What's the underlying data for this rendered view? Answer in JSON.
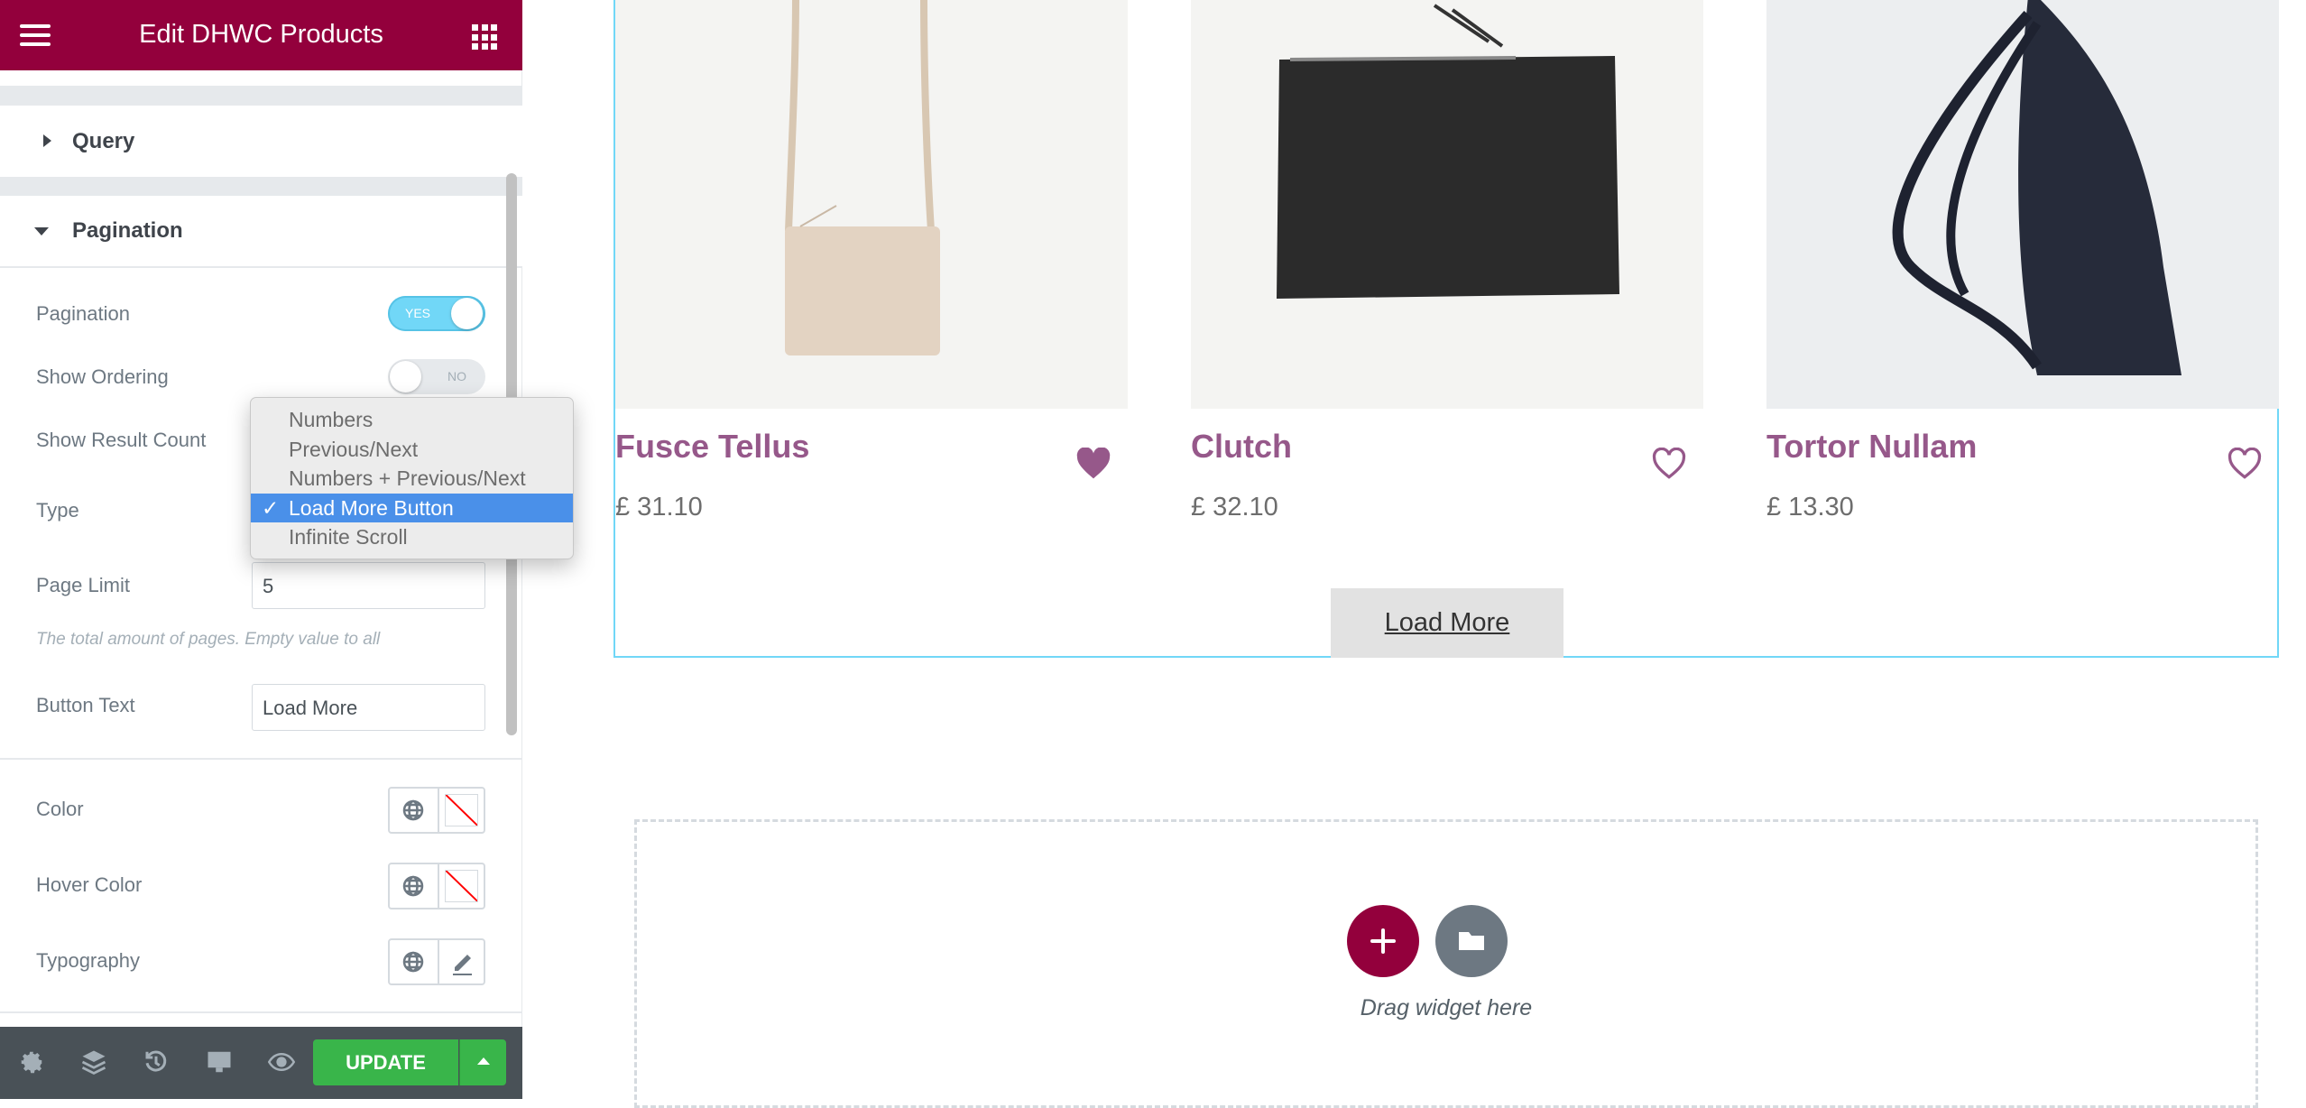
{
  "header": {
    "title": "Edit DHWC Products",
    "menu_icon": "hamburger-icon",
    "apps_icon": "grid-icon",
    "color": "#93003c"
  },
  "sections": {
    "query": "Query",
    "pagination": "Pagination"
  },
  "controls": {
    "pagination": {
      "label": "Pagination",
      "state": "YES"
    },
    "show_ordering": {
      "label": "Show Ordering",
      "state": "NO"
    },
    "show_result_count": {
      "label": "Show Result Count"
    },
    "type": {
      "label": "Type",
      "options": [
        "Numbers",
        "Previous/Next",
        "Numbers + Previous/Next",
        "Load More Button",
        "Infinite Scroll"
      ],
      "selected": "Load More Button",
      "check": "✓"
    },
    "page_limit": {
      "label": "Page Limit",
      "value": "5",
      "help": "The total amount of pages. Empty value to all"
    },
    "button_text": {
      "label": "Button Text",
      "value": "Load More"
    },
    "color": {
      "label": "Color"
    },
    "hover_color": {
      "label": "Hover Color"
    },
    "typography": {
      "label": "Typography"
    }
  },
  "footer": {
    "update": "UPDATE",
    "icons": [
      "gear-icon",
      "layers-icon",
      "history-icon",
      "desktop-icon",
      "eye-icon"
    ],
    "accent": "#39b54a"
  },
  "products": [
    {
      "name": "Fusce Tellus",
      "price": "£ 31.10",
      "favorited": true
    },
    {
      "name": "Clutch",
      "price": "£ 32.10",
      "favorited": false
    },
    {
      "name": "Tortor Nullam",
      "price": "£ 13.30",
      "favorited": false
    }
  ],
  "load_more": "Load More",
  "dropzone": {
    "text": "Drag widget here"
  }
}
